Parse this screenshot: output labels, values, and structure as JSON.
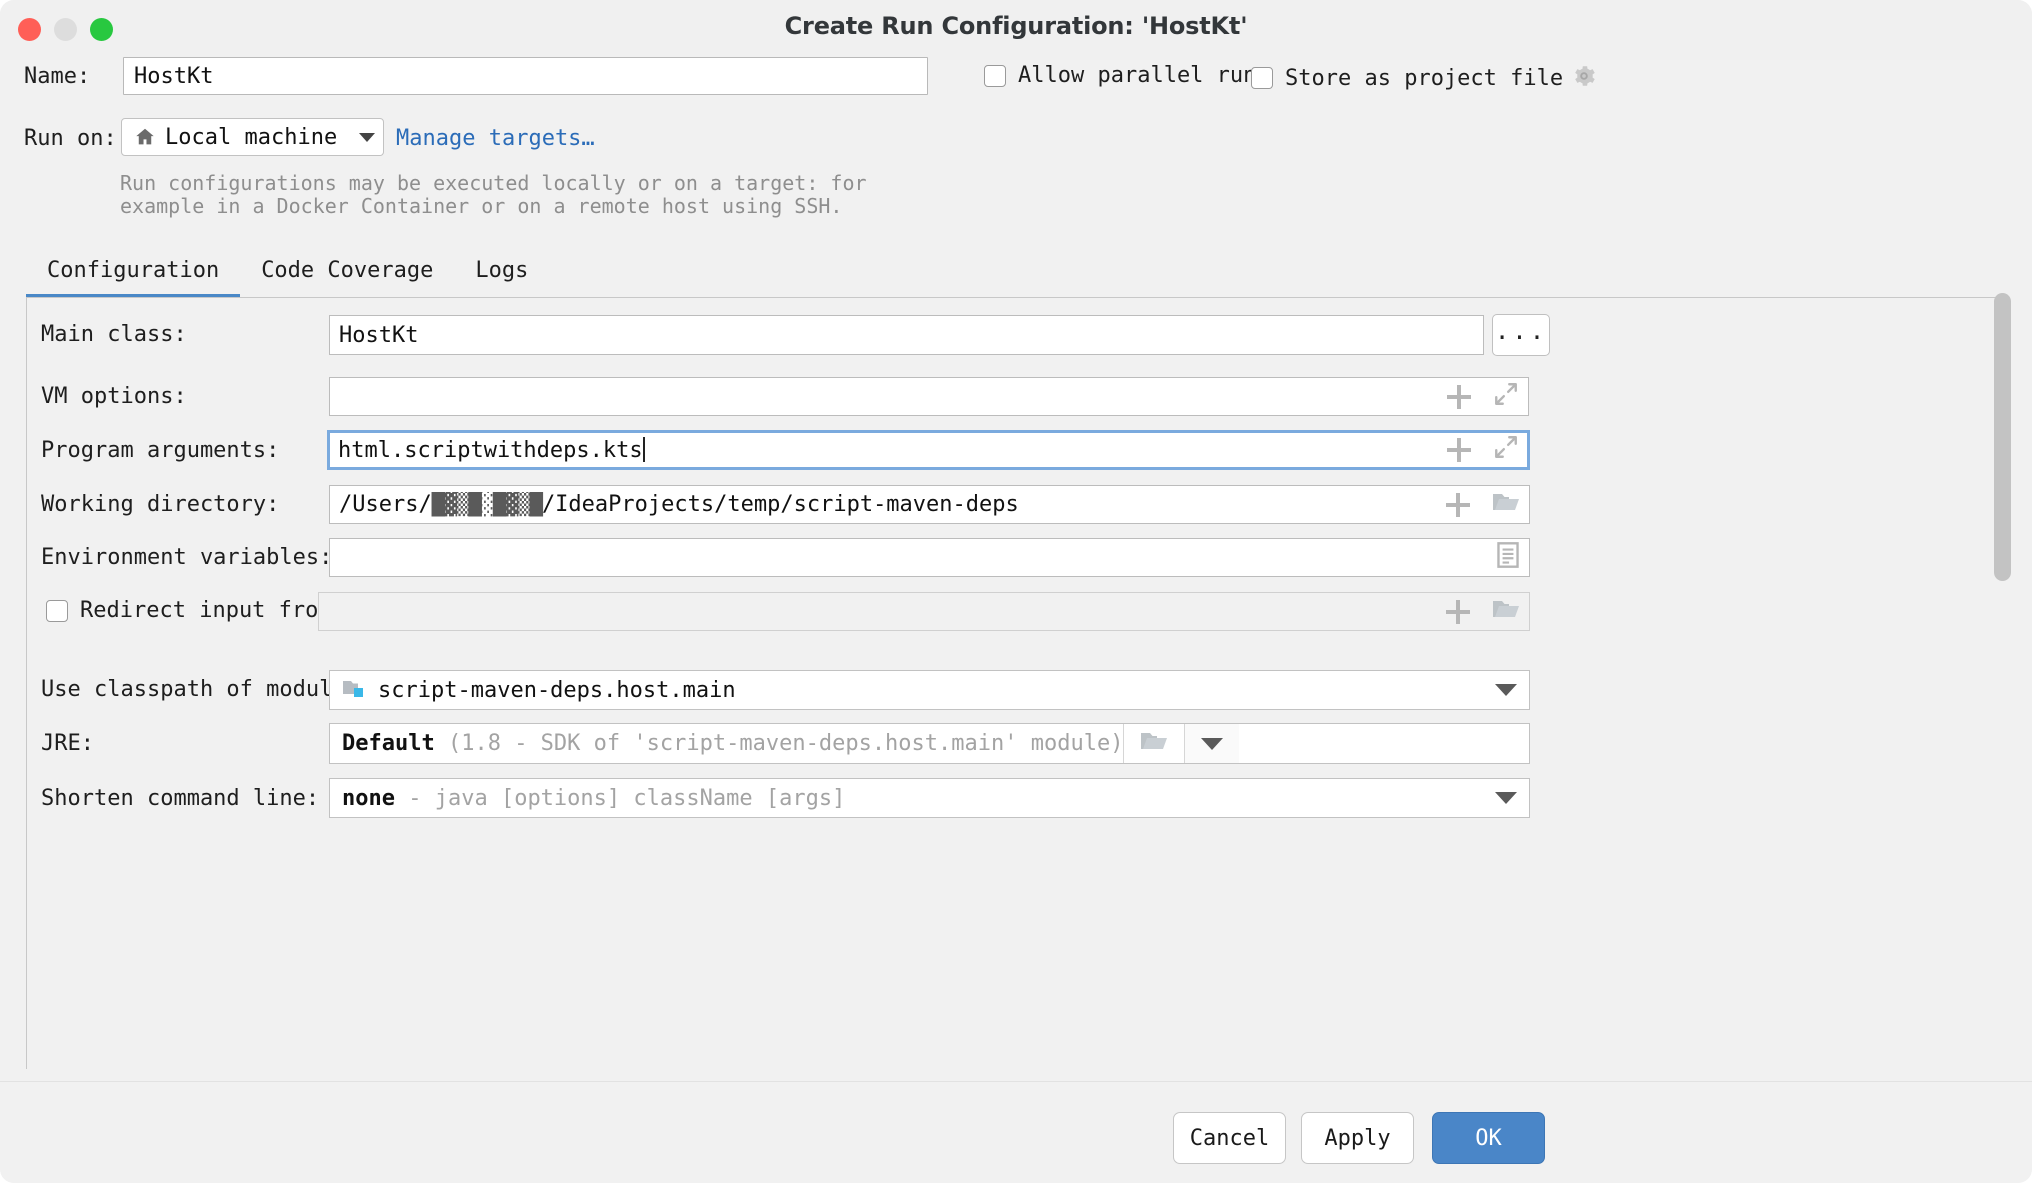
{
  "window": {
    "title": "Create Run Configuration: 'HostKt'",
    "traffic_lights": [
      "close",
      "minimize",
      "zoom"
    ]
  },
  "header": {
    "name_label": "Name:",
    "name_value": "HostKt",
    "allow_parallel_run_label": "Allow parallel run",
    "allow_parallel_run_checked": false,
    "store_as_project_file_label": "Store as project file",
    "store_as_project_file_checked": false,
    "gear_icon": "gear-icon",
    "run_on_label": "Run on:",
    "run_on_value": "Local machine",
    "run_on_icon": "home-icon",
    "manage_targets_link": "Manage targets…",
    "hint_text": "Run configurations may be executed locally or on a target: for\nexample in a Docker Container or on a remote host using SSH."
  },
  "tabs": [
    {
      "label": "Configuration",
      "active": true
    },
    {
      "label": "Code Coverage",
      "active": false
    },
    {
      "label": "Logs",
      "active": false
    }
  ],
  "form": {
    "main_class": {
      "label": "Main class:",
      "value": "HostKt",
      "browse_label": "..."
    },
    "vm_options": {
      "label": "VM options:",
      "value": "",
      "icons": [
        "plus-icon",
        "expand-icon"
      ]
    },
    "program_arguments": {
      "label": "Program arguments:",
      "value": "html.scriptwithdeps.kts",
      "focused": true,
      "icons": [
        "plus-icon",
        "expand-icon"
      ]
    },
    "working_directory": {
      "label": "Working directory:",
      "value_prefix": "/Users/",
      "value_redacted": "█▓▒█░█▓▒█",
      "value_suffix": "/IdeaProjects/temp/script-maven-deps",
      "icons": [
        "plus-icon",
        "folder-icon"
      ]
    },
    "environment_variables": {
      "label": "Environment variables:",
      "value": "",
      "icons": [
        "list-edit-icon"
      ]
    },
    "redirect_input": {
      "label": "Redirect input from:",
      "checked": false,
      "value": "",
      "disabled": true,
      "icons": [
        "plus-icon",
        "folder-icon"
      ]
    },
    "classpath_module": {
      "label": "Use classpath of module:",
      "value": "script-maven-deps.host.main",
      "icon": "module-folder-icon"
    },
    "jre": {
      "label": "JRE:",
      "value": "Default",
      "value_detail": "(1.8 - SDK of 'script-maven-deps.host.main' module)",
      "icons": [
        "folder-icon",
        "chevron-down-icon"
      ]
    },
    "shorten_command_line": {
      "label": "Shorten command line:",
      "value": "none",
      "value_detail": "- java [options] className [args]",
      "icons": [
        "chevron-down-icon"
      ]
    }
  },
  "footer": {
    "cancel_label": "Cancel",
    "apply_label": "Apply",
    "ok_label": "OK"
  },
  "colors": {
    "accent": "#4a86c8",
    "link": "#2b6cb8",
    "tab_underline": "#4a88c7",
    "focus_border": "#7aaade"
  }
}
